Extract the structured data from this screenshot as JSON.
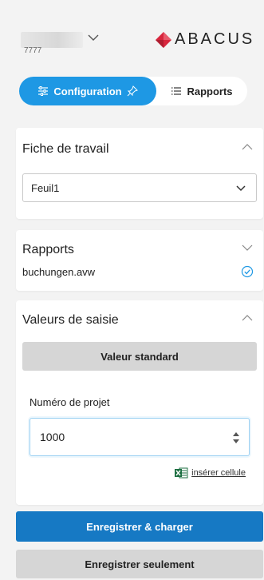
{
  "header": {
    "tenant_code": "7777",
    "logo_text": "ABACUS",
    "chevron_icon": "chevron-down-icon",
    "colors": {
      "logo_red": "#d7263d"
    }
  },
  "tabs": {
    "configuration": {
      "label": "Configuration",
      "icon": "sliders-icon",
      "pin_icon": "pin-icon",
      "active": true
    },
    "reports": {
      "label": "Rapports",
      "icon": "list-icon",
      "active": false
    }
  },
  "worksheet": {
    "title": "Fiche de travail",
    "selected_sheet": "Feuil1",
    "expanded": true
  },
  "reports_card": {
    "title": "Rapports",
    "file": "buchungen.avw",
    "expanded": false
  },
  "input_values": {
    "title": "Valeurs de saisie",
    "standard_button": "Valeur standard",
    "project_label": "Numéro de projet",
    "project_value": "1000",
    "insert_cell_link": "insérer cellule",
    "expanded": true
  },
  "actions": {
    "save_load": "Enregistrer & charger",
    "save_only": "Enregistrer seulement"
  },
  "colors": {
    "accent": "#1e98e4",
    "primary_button": "#1679c4",
    "secondary_button": "#d6d6d6",
    "background": "#f3f3f3",
    "excel_green": "#1d6f42"
  }
}
